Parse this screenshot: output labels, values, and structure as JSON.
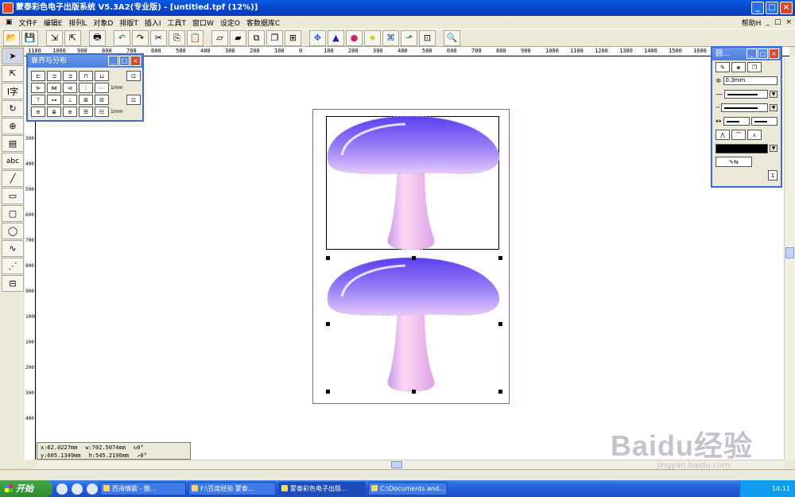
{
  "window": {
    "title": "蒙泰彩色电子出版系统 V5.3A2(专业版) - [untitled.tpf (12%)]",
    "controls": [
      "_",
      "□",
      "×"
    ]
  },
  "menubar": {
    "items": [
      "文件F",
      "编辑E",
      "排列L",
      "对象D",
      "排版T",
      "插入I",
      "工具T",
      "窗口W",
      "设定O",
      "客数据库C"
    ],
    "help": "帮助H",
    "doc_controls": [
      "_",
      "□",
      "×"
    ]
  },
  "toolbar": {
    "icons": [
      "open-icon",
      "save-icon",
      "import-icon",
      "export-icon",
      "print-icon",
      "undo-icon",
      "redo-icon",
      "cut-icon",
      "copy-icon",
      "paste-icon",
      "front-icon",
      "back-icon",
      "forward-icon",
      "backward-icon",
      "group-icon",
      "move-icon",
      "shapes-icon",
      "color-icon",
      "star-icon",
      "library-icon",
      "frame-icon",
      "text-frame-icon",
      "preview-icon"
    ]
  },
  "ruler_top": [
    "1100",
    "1000",
    "900",
    "800",
    "700",
    "600",
    "500",
    "400",
    "300",
    "200",
    "100",
    "0",
    "100",
    "200",
    "300",
    "400",
    "500",
    "600",
    "700",
    "800",
    "900",
    "1000",
    "1100",
    "1200",
    "1300",
    "1400",
    "1500",
    "1600"
  ],
  "ruler_left": [
    "100",
    "200",
    "300",
    "400",
    "500",
    "600",
    "700",
    "800",
    "900",
    "1000",
    "100",
    "200",
    "300",
    "400"
  ],
  "left_tools": [
    "arrow-tool",
    "node-tool",
    "text-tool",
    "rotate-tool",
    "zoom-tool",
    "page-tool",
    "abc-tool",
    "line-tool",
    "rect-tool",
    "roundrect-tool",
    "ellipse-tool",
    "curve-tool",
    "pen-tool",
    "measure-tool"
  ],
  "align_panel": {
    "title": "靠齐与分布",
    "unit_1": "1mm",
    "unit_2": "1mm"
  },
  "prop_panel": {
    "title": "圆...",
    "line_width": "0.3mm",
    "page_button": "1"
  },
  "coords": {
    "x": "x:62.0227mm",
    "y": "y:605.1349mm",
    "w": "w:702.5074mm",
    "h": "h:545.2196mm",
    "rot": "↻0°",
    "skew": "⇗0°"
  },
  "colors": {
    "title_bar": "#0a5ae0",
    "mushroom_cap": "#8a6df2",
    "mushroom_stem": "#f2b8e8",
    "page_border": "#9a5aa8"
  },
  "taskbar": {
    "start": "开始",
    "tasks": [
      "西海情歌 - 酷...",
      "F:\\百度经验 蒙泰...",
      "蒙泰彩色电子出版...",
      "C:\\Documents and..."
    ],
    "clock": "14:11"
  },
  "watermark": {
    "brand": "Baidu经验",
    "url": "jingyan.baidu.com"
  }
}
